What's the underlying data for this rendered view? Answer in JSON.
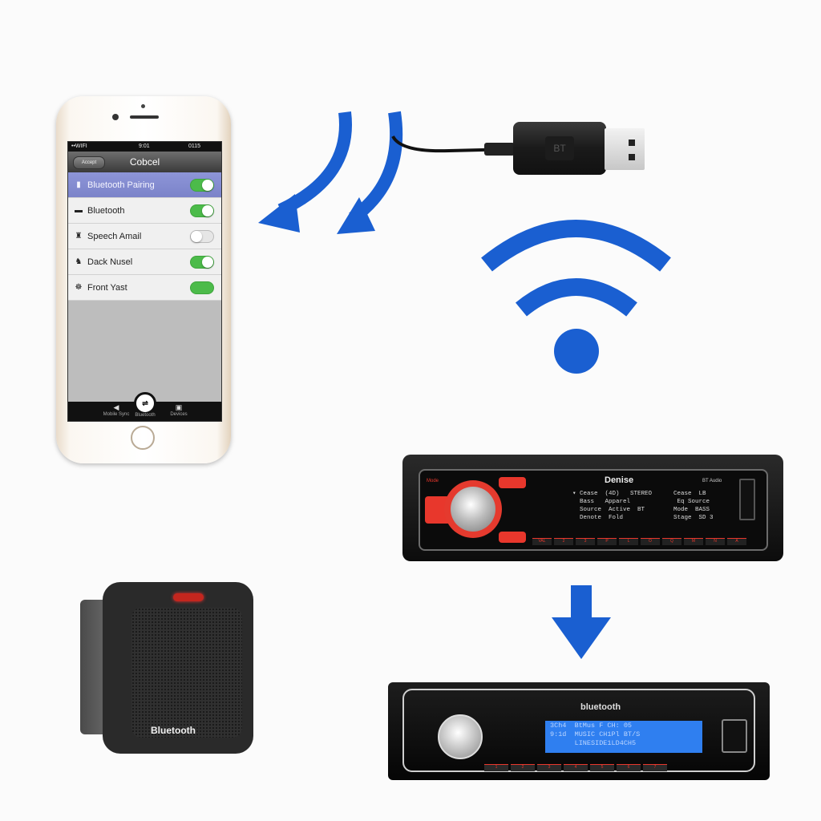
{
  "phone": {
    "status_bar": {
      "carrier": "••WIFI",
      "time": "9:01",
      "battery": "0115"
    },
    "nav": {
      "back_label": "Accept",
      "title": "Cobcel"
    },
    "settings": [
      {
        "label": "Bluetooth Pairing",
        "icon": "phone-icon",
        "glyph": "▮",
        "state": "on",
        "selected": true
      },
      {
        "label": "Bluetooth",
        "icon": "device-icon",
        "glyph": "▬",
        "state": "on",
        "selected": false
      },
      {
        "label": "Speech Amail",
        "icon": "mic-icon",
        "glyph": "♜",
        "state": "off",
        "selected": false
      },
      {
        "label": "Dack Nusel",
        "icon": "car-icon",
        "glyph": "♞",
        "state": "on",
        "selected": false
      },
      {
        "label": "Front Yast",
        "icon": "person-icon",
        "glyph": "☸",
        "state": "on",
        "selected": false
      }
    ],
    "tab_bar": {
      "left": "Mobile Sync",
      "center": "Bluetooth",
      "center_glyph": "⇌",
      "right": "Devices"
    }
  },
  "usb_dongle": {
    "logo": "BT"
  },
  "radio_top": {
    "brand": "Denise",
    "left_label": "Mode",
    "display_lines": [
      "▾ Cease  (4D)   STEREO      Cease  LB",
      "  Bass   Apparel             Eq Source",
      "  Source  Active  BT        Mode  BASS",
      "  Denote  Fold              Stage  SD 3"
    ],
    "corner_label": "BT Audio",
    "keys": [
      "VAL",
      "2",
      "3",
      "P",
      "L",
      "O",
      "Q",
      "M",
      "N",
      "A"
    ],
    "colors": {
      "accent": "#e8372c"
    }
  },
  "radio_bottom": {
    "brand": "bluetooth",
    "display_lines": [
      "3Ch4  BtMus F CH: 05",
      "9:1d  MUSIC CH1Pl BT/S",
      "      LINESIDE1LD4CH5"
    ],
    "keys": [
      "1",
      "2",
      "3",
      "4",
      "5",
      "6",
      "7"
    ],
    "key_labels": [
      "Ba",
      "8",
      "4",
      "V",
      "5",
      "6"
    ],
    "colors": {
      "display": "#2f7ff0"
    }
  },
  "speaker": {
    "label": "Bluetooth"
  },
  "colors": {
    "brand_blue": "#1a5fd1",
    "toggle_green": "#4cbb4a"
  }
}
